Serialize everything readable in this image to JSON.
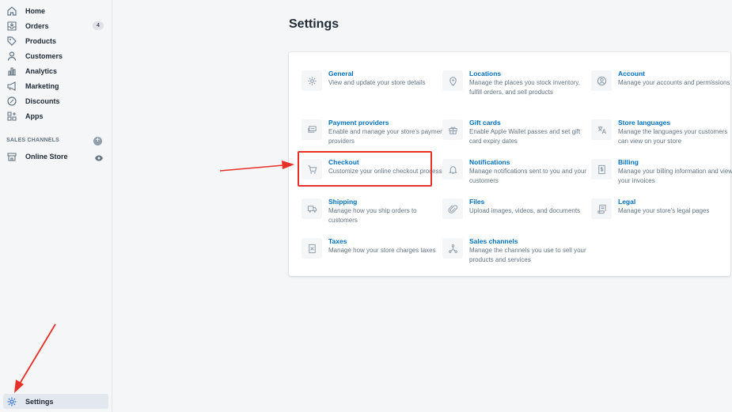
{
  "sidebar": {
    "items": [
      {
        "label": "Home",
        "icon": "home-icon"
      },
      {
        "label": "Orders",
        "icon": "orders-icon",
        "badge": "4"
      },
      {
        "label": "Products",
        "icon": "tag-icon"
      },
      {
        "label": "Customers",
        "icon": "person-icon"
      },
      {
        "label": "Analytics",
        "icon": "bar-chart-icon"
      },
      {
        "label": "Marketing",
        "icon": "megaphone-icon"
      },
      {
        "label": "Discounts",
        "icon": "discount-icon"
      },
      {
        "label": "Apps",
        "icon": "apps-icon"
      }
    ],
    "sales_channels_label": "SALES CHANNELS",
    "online_store": {
      "label": "Online Store",
      "icon": "store-icon"
    },
    "settings": {
      "label": "Settings",
      "icon": "gear-icon"
    }
  },
  "page": {
    "title": "Settings"
  },
  "settings_tiles": [
    {
      "title": "General",
      "desc": "View and update your store details",
      "icon": "gear-icon"
    },
    {
      "title": "Locations",
      "desc": "Manage the places you stock inventory, fulfill orders, and sell products",
      "icon": "location-pin-icon"
    },
    {
      "title": "Account",
      "desc": "Manage your accounts and permissions",
      "icon": "account-icon"
    },
    {
      "title": "Payment providers",
      "desc": "Enable and manage your store's payment providers",
      "icon": "payment-icon"
    },
    {
      "title": "Gift cards",
      "desc": "Enable Apple Wallet passes and set gift card expiry dates",
      "icon": "gift-icon"
    },
    {
      "title": "Store languages",
      "desc": "Manage the languages your customers can view on your store",
      "icon": "translate-icon"
    },
    {
      "title": "Checkout",
      "desc": "Customize your online checkout process",
      "icon": "cart-icon"
    },
    {
      "title": "Notifications",
      "desc": "Manage notifications sent to you and your customers",
      "icon": "bell-icon"
    },
    {
      "title": "Billing",
      "desc": "Manage your billing information and view your invoices",
      "icon": "billing-icon"
    },
    {
      "title": "Shipping",
      "desc": "Manage how you ship orders to customers",
      "icon": "truck-icon"
    },
    {
      "title": "Files",
      "desc": "Upload images, videos, and documents",
      "icon": "paperclip-icon"
    },
    {
      "title": "Legal",
      "desc": "Manage your store's legal pages",
      "icon": "legal-icon"
    },
    {
      "title": "Taxes",
      "desc": "Manage how your store charges taxes",
      "icon": "taxes-icon"
    },
    {
      "title": "Sales channels",
      "desc": "Manage the channels you use to sell your products and services",
      "icon": "channels-icon"
    }
  ],
  "colors": {
    "link": "#006fbb",
    "annotation": "#e8302a"
  }
}
